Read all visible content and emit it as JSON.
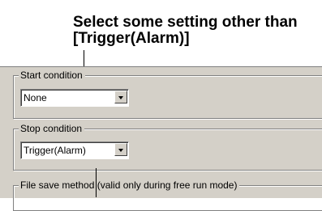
{
  "callout": {
    "line1": "Select some setting other than",
    "line2": "[Trigger(Alarm)]"
  },
  "start_condition": {
    "title": "Start condition",
    "value": "None",
    "dropdown_icon": "chevron-down-icon"
  },
  "stop_condition": {
    "title": "Stop condition",
    "value": "Trigger(Alarm)",
    "dropdown_icon": "chevron-down-icon"
  },
  "file_save": {
    "title": "File save method (valid only during free run mode)"
  }
}
